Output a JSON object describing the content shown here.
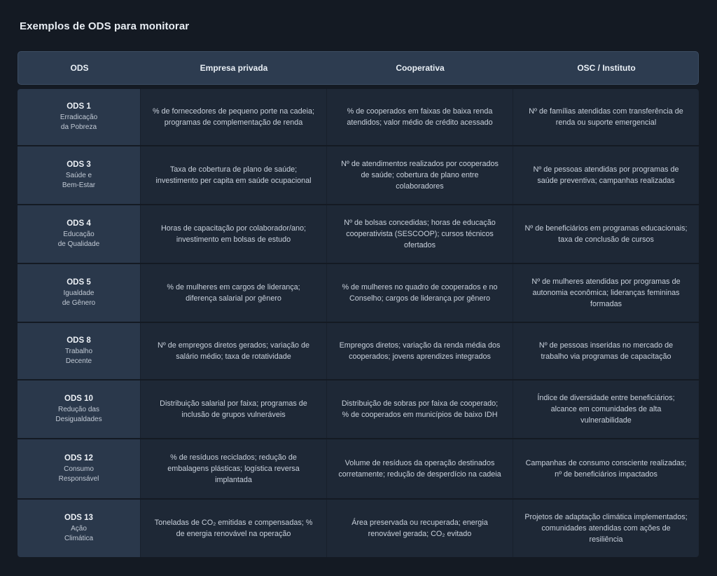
{
  "title": "Exemplos de ODS para monitorar",
  "headers": [
    "ODS",
    "Empresa privada",
    "Cooperativa",
    "OSC / Instituto"
  ],
  "colors": {
    "background": "#141a23",
    "header": "#2d3c50",
    "ods_cell": "#2a384b",
    "cell": "#1e2836"
  },
  "rows": [
    {
      "code": "ODS 1",
      "name": "Erradicação\nda Pobreza",
      "empresa": "% de fornecedores de pequeno porte na cadeia; programas de complementação de renda",
      "cooperativa": "% de cooperados em faixas de baixa renda atendidos; valor médio de crédito acessado",
      "osc": "Nº de famílias atendidas com transferência de renda ou suporte emergencial"
    },
    {
      "code": "ODS 3",
      "name": "Saúde e\nBem-Estar",
      "empresa": "Taxa de cobertura de plano de saúde; investimento per capita em saúde ocupacional",
      "cooperativa": "Nº de atendimentos realizados por cooperados de saúde; cobertura de plano entre colaboradores",
      "osc": "Nº de pessoas atendidas por programas de saúde preventiva; campanhas realizadas"
    },
    {
      "code": "ODS 4",
      "name": "Educação\nde Qualidade",
      "empresa": "Horas de capacitação por colaborador/ano; investimento em bolsas de estudo",
      "cooperativa": "Nº de bolsas concedidas; horas de educação cooperativista (SESCOOP); cursos técnicos ofertados",
      "osc": "Nº de beneficiários em programas educacionais; taxa de conclusão de cursos"
    },
    {
      "code": "ODS 5",
      "name": "Igualdade\nde Gênero",
      "empresa": "% de mulheres em cargos de liderança; diferença salarial por gênero",
      "cooperativa": "% de mulheres no quadro de cooperados e no Conselho; cargos de liderança por gênero",
      "osc": "Nº de mulheres atendidas por programas de autonomia econômica; lideranças femininas formadas"
    },
    {
      "code": "ODS 8",
      "name": "Trabalho\nDecente",
      "empresa": "Nº de empregos diretos gerados; variação de salário médio; taxa de rotatividade",
      "cooperativa": "Empregos diretos; variação da renda média dos cooperados; jovens aprendizes integrados",
      "osc": "Nº de pessoas inseridas no mercado de trabalho via programas de capacitação"
    },
    {
      "code": "ODS 10",
      "name": "Redução das\nDesigualdades",
      "empresa": "Distribuição salarial por faixa; programas de inclusão de grupos vulneráveis",
      "cooperativa": "Distribuição de sobras por faixa de cooperado; % de cooperados em municípios de baixo IDH",
      "osc": "Índice de diversidade entre beneficiários; alcance em comunidades de alta vulnerabilidade"
    },
    {
      "code": "ODS 12",
      "name": "Consumo\nResponsável",
      "empresa": "% de resíduos reciclados; redução de embalagens plásticas; logística reversa implantada",
      "cooperativa": "Volume de resíduos da operação destinados corretamente; redução de desperdício na cadeia",
      "osc": "Campanhas de consumo consciente realizadas; nº de beneficiários impactados"
    },
    {
      "code": "ODS 13",
      "name": "Ação\nClimática",
      "empresa": "Toneladas de CO₂ emitidas e compensadas; % de energia renovável na operação",
      "cooperativa": "Área preservada ou recuperada; energia renovável gerada; CO₂ evitado",
      "osc": "Projetos de adaptação climática implementados; comunidades atendidas com ações de resiliência"
    }
  ]
}
